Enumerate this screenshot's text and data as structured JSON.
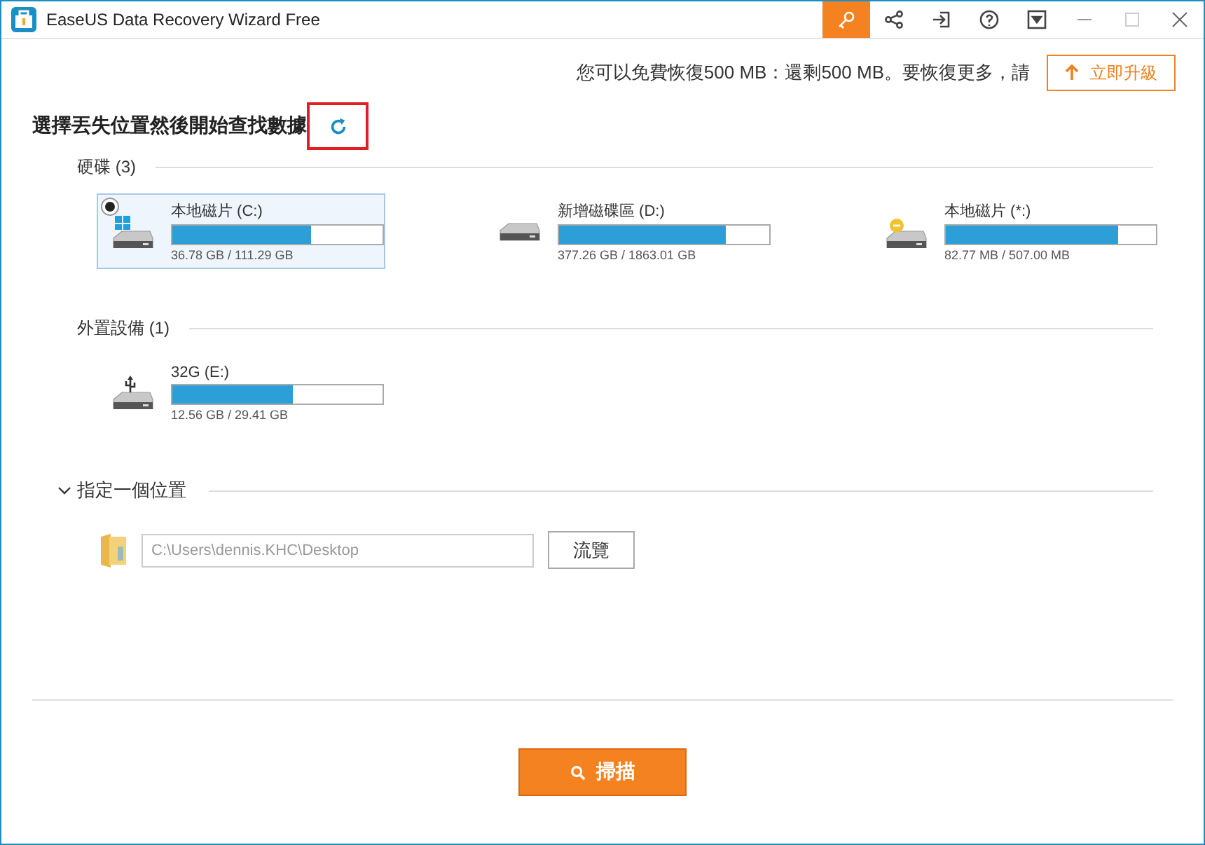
{
  "window": {
    "title": "EaseUS Data Recovery Wizard Free",
    "toolbar": [
      {
        "kind": "key",
        "selected": true
      },
      {
        "kind": "share",
        "selected": false
      },
      {
        "kind": "exit",
        "selected": false
      },
      {
        "kind": "help",
        "selected": false
      },
      {
        "kind": "dropdown",
        "selected": false
      }
    ]
  },
  "quota": {
    "text": "您可以免費恢復500 MB：還剩500 MB。要恢復更多，請",
    "upgrade_button": "立即升級"
  },
  "heading": {
    "text": "選擇丟失位置然後開始查找數據",
    "refresh_highlighted": true
  },
  "sections": [
    {
      "title": "硬碟 (3)",
      "drives": [
        {
          "kind": "windows",
          "name": "本地磁片 (C:)",
          "usage": "36.78 GB / 111.29 GB",
          "level": 0.66,
          "selected": true
        },
        {
          "kind": "plain",
          "name": "新增磁碟區 (D:)",
          "usage": "377.26 GB / 1863.01 GB",
          "level": 0.79,
          "selected": false
        },
        {
          "kind": "minus",
          "name": "本地磁片 (*:)",
          "usage": "82.77 MB / 507.00 MB",
          "level": 0.82,
          "selected": false
        }
      ]
    },
    {
      "title": "外置設備 (1)",
      "drives": [
        {
          "kind": "usb",
          "name": "32G (E:)",
          "usage": "12.56 GB / 29.41 GB",
          "level": 0.57,
          "selected": false
        }
      ]
    }
  ],
  "location": {
    "title": "指定一個位置",
    "expanded": true,
    "path_placeholder": "C:\\Users\\dennis.KHC\\Desktop",
    "browse_button": "流覽"
  },
  "scan_button": "掃描"
}
